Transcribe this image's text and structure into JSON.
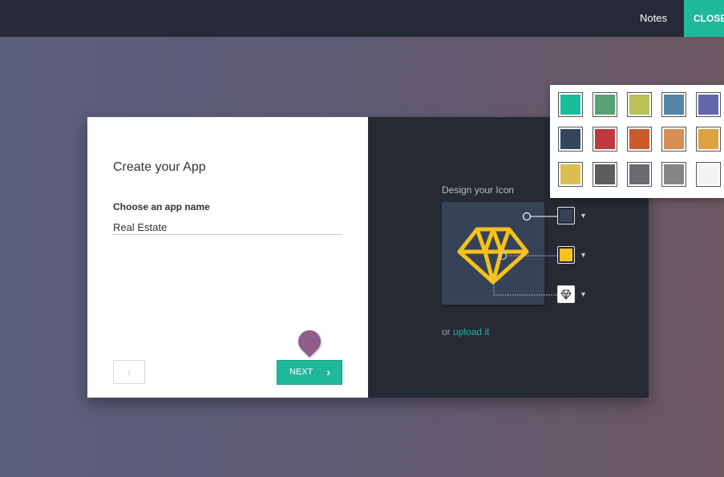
{
  "topbar": {
    "notes_label": "Notes",
    "close_label": "CLOSE"
  },
  "form": {
    "title": "Create your App",
    "name_label": "Choose an app name",
    "name_value": "Real Estate",
    "prev_icon": "chevron-left-icon",
    "next_label": "NEXT",
    "next_icon": "chevron-right-icon"
  },
  "icon_designer": {
    "label": "Design your Icon",
    "icon": "diamond-icon",
    "background_color": "#364257",
    "icon_color": "#f5c21b",
    "upload_prefix": "or",
    "upload_link": "upload it"
  },
  "palette": {
    "colors": [
      "#1abc9c",
      "#58a177",
      "#b9c159",
      "#5585a5",
      "#6168ab",
      "#34455e",
      "#c0393f",
      "#cd5a2d",
      "#d78e55",
      "#dca140",
      "#dcbd50",
      "#5d5d5d",
      "#6a6b6e",
      "#858585",
      "#f3f3f3"
    ]
  },
  "colors": {
    "accent": "#20b89a",
    "topbar": "#262a36",
    "tip": "#8f5e8a"
  }
}
